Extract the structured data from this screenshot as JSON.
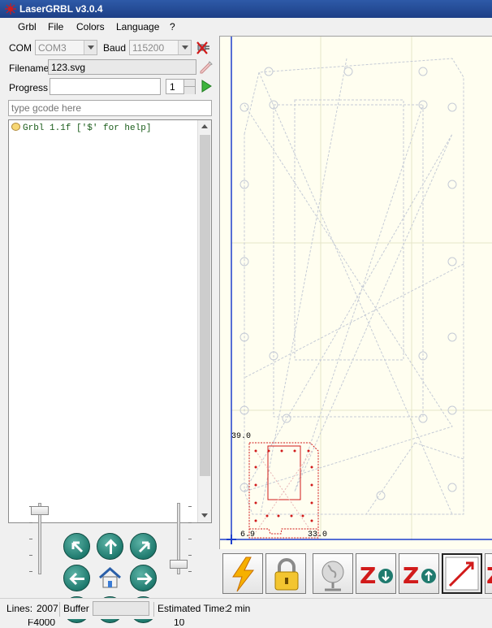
{
  "window": {
    "title": "LaserGRBL v3.0.4"
  },
  "menu": {
    "items": [
      "Grbl",
      "File",
      "Colors",
      "Language",
      "?"
    ]
  },
  "connection": {
    "com_label": "COM",
    "com_value": "COM3",
    "baud_label": "Baud",
    "baud_value": "115200"
  },
  "file": {
    "filename_label": "Filename",
    "filename_value": "123.svg"
  },
  "progress": {
    "label": "Progress",
    "value_fraction": 0,
    "passes": "1"
  },
  "command": {
    "placeholder": "type gcode here"
  },
  "console": {
    "lines": [
      "Grbl 1.1f ['$' for help]"
    ]
  },
  "jog": {
    "speed_label": "F4000",
    "speed_level": 0.95,
    "step_label": "10",
    "step_level": 0.08
  },
  "preview": {
    "label_top_left": "39.0",
    "label_origin": "6.9",
    "label_right": "33.0"
  },
  "status": {
    "lines_label": "Lines:",
    "lines_value": "2007",
    "buffer_label": "Buffer",
    "buffer_fraction": 0,
    "time_label": "Estimated Time:",
    "time_value": "2 min"
  },
  "colors": {
    "accent_red": "#d11a1a",
    "jog_teal": "#1f7a6e",
    "canvas_bg": "#fffef0",
    "title_blue": "#1d3f86"
  }
}
